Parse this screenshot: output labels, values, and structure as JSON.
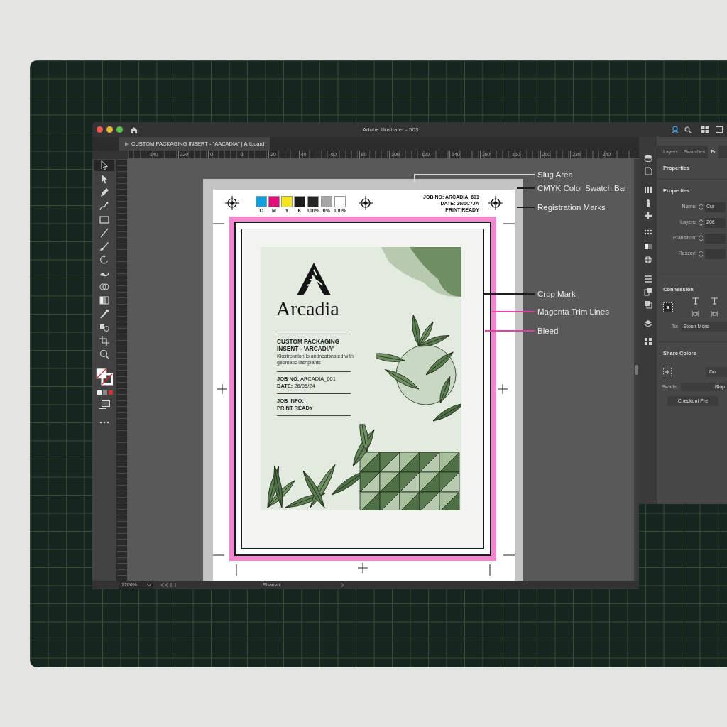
{
  "window": {
    "title": "Adobe Illustrater - 503"
  },
  "document_tab": {
    "title": "CUSTOM PACKAGING INSERT - \"AACADIA\" | Artboard",
    "selected": true
  },
  "ruler": {
    "labels": [
      "140",
      "230",
      "0",
      "0",
      "20",
      "40",
      "60",
      "80",
      "100",
      "120",
      "140",
      "160",
      "160",
      "200",
      "230",
      "240"
    ]
  },
  "tools": [
    {
      "kind": "selection",
      "selected": true
    },
    {
      "kind": "direct",
      "selected": false
    },
    {
      "kind": "pen",
      "selected": false
    },
    {
      "kind": "curvature",
      "selected": false
    },
    {
      "kind": "rectangle",
      "selected": false
    },
    {
      "kind": "line",
      "selected": false
    },
    {
      "kind": "brush",
      "selected": false
    },
    {
      "kind": "rotate",
      "selected": false
    },
    {
      "kind": "warp",
      "selected": false
    },
    {
      "kind": "shapebuilder",
      "selected": false
    },
    {
      "kind": "gradient",
      "selected": false
    },
    {
      "kind": "eyedropper",
      "selected": false
    },
    {
      "kind": "blend",
      "selected": false
    },
    {
      "kind": "crop",
      "selected": false
    },
    {
      "kind": "zoom",
      "selected": false
    }
  ],
  "artboard": {
    "swatches": [
      {
        "label": "C",
        "color": "#12a0dc"
      },
      {
        "label": "M",
        "color": "#e0117f"
      },
      {
        "label": "Y",
        "color": "#f6e51b"
      },
      {
        "label": "K",
        "color": "#1c1c1c"
      },
      {
        "label": "100%",
        "color": "#262626"
      },
      {
        "label": "0%",
        "color": "#a6a6a6"
      },
      {
        "label": "100%",
        "color": "#ffffff"
      }
    ],
    "slug_info": [
      "JOB NO: ARCADIA_601",
      "DATE: 26/0C7JA",
      "PRINT READY"
    ],
    "design": {
      "brand": "Arcadia",
      "title": "CUSTOM PACKAGING INSENT - 'ARCADIA'",
      "description": "Klustrolution lo antincatsnated with geomatic lashplants",
      "job_lines": [
        "**JOB NO:** ARCADIA_001",
        "**DATE:** 26/05/24"
      ],
      "info_lines": [
        "JOB INFO:",
        "PRINT READY"
      ]
    }
  },
  "callouts": [
    {
      "label": "Slug Area",
      "color": "#d9d9d9"
    },
    {
      "label": "CMYK Color Swatch Bar",
      "color": "#1e1e1e"
    },
    {
      "label": "Registration Marks",
      "color": "#1e1e1e"
    },
    {
      "label": "Crop Mark",
      "color": "#1e1e1e"
    },
    {
      "label": "Magenta Trim Lines",
      "color": "#e0409f"
    },
    {
      "label": "Bleed",
      "color": "#e0409f"
    }
  ],
  "status_bar": {
    "zoom": "1200%",
    "artboard_name": "Shanvni"
  },
  "panel": {
    "tabs": [
      {
        "label": "Layers",
        "selected": false
      },
      {
        "label": "Swatches",
        "selected": false
      },
      {
        "label": "Pr",
        "selected": true
      }
    ],
    "header": "Properties",
    "section": "Properties",
    "fields": [
      {
        "label": "Name:",
        "value": "Cur"
      },
      {
        "label": "Layers:",
        "value": "206"
      },
      {
        "label": "Pransition:"
      },
      {
        "label": "Reszey:"
      }
    ],
    "alignment": {
      "title": "Connession",
      "to_label": "To:",
      "to_value": "Stoun Mors"
    },
    "share_colors": {
      "title": "Share Colors",
      "button": "Du",
      "swatch_label": "Swatle:",
      "swatch_value": "Blop",
      "action": "Checkont Pre"
    }
  }
}
